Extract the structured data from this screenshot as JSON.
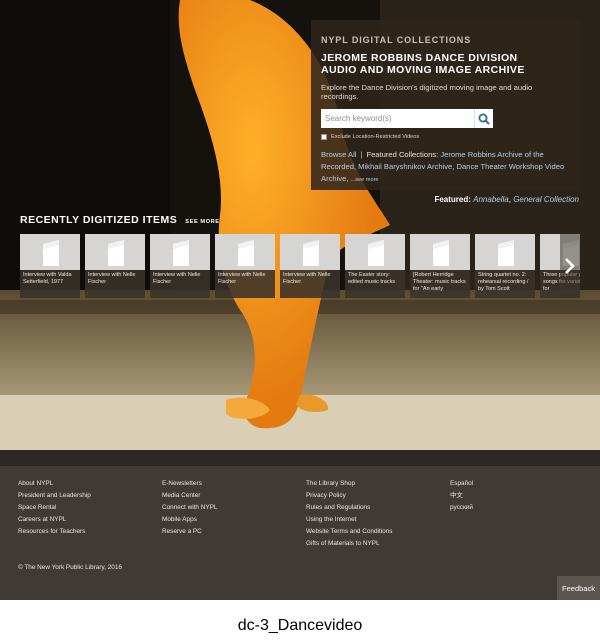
{
  "panel": {
    "kicker": "NYPL DIGITAL COLLECTIONS",
    "title_line1": "JEROME ROBBINS DANCE DIVISION",
    "title_line2": "AUDIO AND MOVING IMAGE ARCHIVE",
    "description": "Explore the Dance Division's digitized moving image and audio recordings.",
    "search_placeholder": "Search keyword(s)",
    "search_icon": "search-icon",
    "checkbox_label": "Exclude Location-Restricted Videos",
    "checkbox_checked": false,
    "browse_all": "Browse All",
    "separator": "|",
    "featured_collections_label": "Featured Collections:",
    "collection_1": "Jerome Robbins Archive of the Recorded,",
    "collection_2": "Mikhail Baryshnikov Archive,",
    "collection_3": "Dance Theater Workshop Video Archive,",
    "see_more": "...see more"
  },
  "featured": {
    "label": "Featured:",
    "link_1": "Annabella",
    "comma": ", ",
    "link_2": "General Collection"
  },
  "recent": {
    "heading": "RECENTLY DIGITIZED ITEMS",
    "see_more": "SEE MORE",
    "thumb_icon": "music-note-icon",
    "next_icon": "chevron-right-icon",
    "items": [
      {
        "caption": "Interview with Valda Setterfield, 1977"
      },
      {
        "caption": "Interview with Nelle Fischer"
      },
      {
        "caption": "Interview with Nelle Fischer"
      },
      {
        "caption": "Interview with Nelle Fischer"
      },
      {
        "caption": "Interview with Nelle Fischer"
      },
      {
        "caption": "The Easter story: edited music tracks"
      },
      {
        "caption": "[Robert Herridge Theater: music tracks for \"An early"
      },
      {
        "caption": "String quartet no. 2: rehearsal recording / by Tom Scott"
      },
      {
        "caption": "Three popular pop songs for variations for"
      }
    ]
  },
  "footer": {
    "col1": [
      "About NYPL",
      "President and Leadership",
      "Space Rental",
      "Careers at NYPL",
      "Resources for Teachers"
    ],
    "col2": [
      "E-Newsletters",
      "Media Center",
      "Connect with NYPL",
      "Mobile Apps",
      "Reserve a PC"
    ],
    "col3": [
      "The Library Shop",
      "Privacy Policy",
      "Rules and Regulations",
      "Using the Internet",
      "Website Terms and Conditions",
      "Gifts of Materials to NYPL"
    ],
    "col4": [
      "Español",
      "中文",
      "русский"
    ],
    "copyright": "© The New York Public Library, 2016",
    "feedback": "Feedback"
  },
  "caption": "dc-3_Dancevideo",
  "colors": {
    "panel_bg": "#2d241b",
    "link": "#b7cfe2",
    "footer_bg": "#403a36",
    "dancer_orange": "#f29a1a"
  }
}
